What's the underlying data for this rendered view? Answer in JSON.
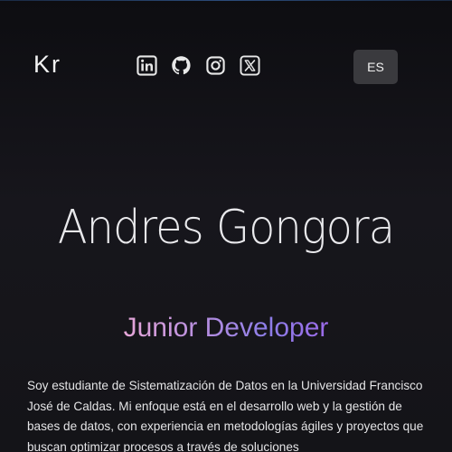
{
  "header": {
    "logo": "Kr",
    "language_button": "ES",
    "socials": [
      {
        "icon": "linkedin-icon"
      },
      {
        "icon": "github-icon"
      },
      {
        "icon": "instagram-icon"
      },
      {
        "icon": "x-icon"
      }
    ]
  },
  "hero": {
    "name": "Andres Gongora",
    "role": "Junior Developer",
    "bio": "Soy estudiante de Sistematización de Datos en la Universidad Francisco José de Caldas. Mi enfoque está en el desarrollo web y la gestión de bases de datos, con experiencia en metodologías ágiles y proyectos que buscan optimizar procesos a través de soluciones"
  },
  "colors": {
    "background": "#141418",
    "button": "#3a3a3e",
    "role_gradient_start": "#e6a6d8",
    "role_gradient_end": "#9b6ae8"
  }
}
